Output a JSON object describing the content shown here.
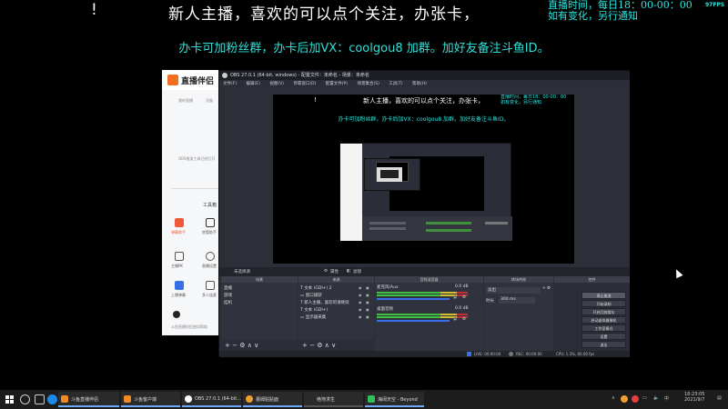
{
  "overlay": {
    "exclaim": "!",
    "line1": "新人主播，喜欢的可以点个关注，办张卡，",
    "line2": "办卡可加粉丝群，办卡后加VX：coolgou8 加群。加好友备注斗鱼ID。",
    "schedule_line1": "直播时间，每日18：00-00：00",
    "schedule_line2": "如有变化，另行通知",
    "fps_badge": "97FPS"
  },
  "douyu_helper": {
    "app_title": "直播伴侣",
    "menu_left": "我的直播",
    "menu_right": "设备",
    "obs_hint": "OBS推流工具已经打开",
    "tools_header": "工具箱",
    "tools": [
      {
        "label": "弹幕助手",
        "color": "#f05a3c"
      },
      {
        "label": "房管助手",
        "color": "#3a3a3a"
      },
      {
        "label": "主播PK",
        "color": "#555555"
      },
      {
        "label": "直播设置",
        "color": "#555555"
      },
      {
        "label": "上播弹幕",
        "color": "#3a6ee8"
      },
      {
        "label": "多人连麦",
        "color": "#555555"
      }
    ],
    "footer_text": "斗鱼直播伴侣使用帮助"
  },
  "obs": {
    "title": "OBS 27.0.1 (64-bit, windows) - 配置文件：未命名 - 场景：未命名",
    "menu": [
      "文件(F)",
      "编辑(E)",
      "视图(V)",
      "停靠窗口(D)",
      "配置文件(P)",
      "场景集合(S)",
      "工具(T)",
      "帮助(H)"
    ],
    "preview": {
      "exclaim": "!",
      "line1": "新人主播，喜欢的可以点个关注，办张卡，",
      "line2": "办卡可加粉丝群，办卡后加VX：coolgou8 加群。加好友备注斗鱼ID。",
      "time_line1": "直播时间，每日18：00-00：00",
      "time_line2": "如有变化，另行通知"
    },
    "controls_bar": {
      "no_source": "未选择源",
      "properties": "属性",
      "filters": "滤镜"
    },
    "scenes": {
      "header": "场景",
      "items": [
        "直播",
        "游戏",
        "挂机"
      ]
    },
    "sources": {
      "header": "来源",
      "items": [
        "文本 (GDI+) 2",
        "窗口捕获",
        "新人主播，喜欢的请继续",
        "文本 (GDI+)",
        "显示器采集"
      ]
    },
    "mixer": {
      "header": "音频混音器",
      "channels": [
        {
          "name": "麦克风/Aux",
          "db": "0.0 dB"
        },
        {
          "name": "桌面音频",
          "db": "0.0 dB"
        }
      ]
    },
    "transitions": {
      "header": "转场特效",
      "type": "淡出",
      "duration_label": "时长",
      "duration": "300 ms"
    },
    "controls": {
      "header": "控件",
      "buttons": [
        "停止推流",
        "开始录制",
        "开启回放缓存",
        "启动虚拟摄像机",
        "工作室模式",
        "设置",
        "退出"
      ]
    },
    "status": {
      "live": "LIVE: 00:00:00",
      "rec": "REC: 00:00:00",
      "cpu": "CPU: 1.3%, 60.00 fps"
    }
  },
  "taskbar": {
    "tasks": [
      {
        "label": "斗鱼直播伴侣",
        "color": "#f08a24"
      },
      {
        "label": "斗鱼客户端",
        "color": "#f08a24"
      },
      {
        "label": "OBS 27.0.1 (64-bit...",
        "color": "#ffffff"
      },
      {
        "label": "蕾姆贴贴面",
        "color": "#f0a030"
      },
      {
        "label": "绝地求生",
        "color": "#e0a020"
      },
      {
        "label": "海阔天空 - Beyond",
        "color": "#30c060"
      }
    ],
    "clock_time": "18:23:05",
    "clock_date": "2021/9/7"
  }
}
